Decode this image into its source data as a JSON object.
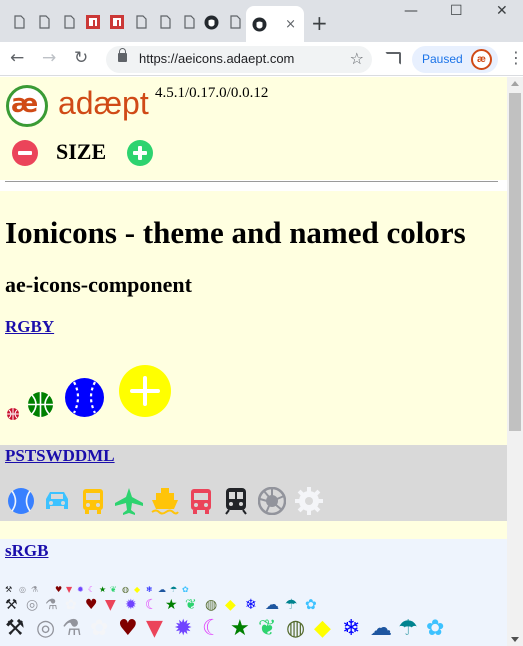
{
  "browser": {
    "tab_count_inactive": 9,
    "active_tab_close": "×",
    "new_tab": "+",
    "window_controls": {
      "minimize": "—",
      "maximize": "☐",
      "close": "✕"
    },
    "nav": {
      "back": "←",
      "forward": "→",
      "reload": "↻"
    },
    "url": "https://aeicons.adaept.com",
    "bookmark_icon": "☆",
    "profile_status": "Paused",
    "menu_icon": "⋮"
  },
  "page": {
    "logo_text": "adæpt",
    "logo_mark": "æ",
    "version": "4.5.1/0.17.0/0.0.12",
    "size_label": "SIZE",
    "title": "Ionicons - theme and named colors",
    "subtitle": "ae-icons-component",
    "sections": [
      {
        "link": "RGBY",
        "icons": [
          "basketball-icon",
          "basketball-icon",
          "baseball-icon",
          "add-circle-icon"
        ]
      },
      {
        "link": "PSTSWDDML",
        "icons": [
          "tennisball-icon",
          "car-icon",
          "bus-icon",
          "airplane-icon",
          "boat-icon",
          "bus-icon",
          "subway-icon",
          "aperture-icon",
          "cog-icon"
        ]
      },
      {
        "link": "sRGB",
        "icons": [
          "build-icon",
          "finger-print-icon",
          "flask-icon",
          "flower-icon",
          "heart-icon",
          "ice-cream-icon",
          "sunny-icon",
          "moon-icon",
          "star-icon",
          "leaf-icon",
          "globe-icon",
          "notifications-icon",
          "snow-icon",
          "rainy-icon",
          "umbrella-icon",
          "rose-icon"
        ]
      }
    ]
  },
  "colors": {
    "header_bg": "#ffffe0",
    "grey_bg": "#d9d9d9",
    "blue_bg": "#eef4fd",
    "brand_orange": "#d04a16",
    "brand_green": "#3a9b35",
    "minus_red": "#eb445a",
    "plus_green": "#2dd36f",
    "link": "#1a0dab",
    "ionic_red": "#c8102e",
    "ionic_green": "#008000",
    "ionic_blue": "#0000ff",
    "ionic_yellow": "#ffff00",
    "primary": "#3880ff",
    "secondary": "#3dc2ff",
    "tertiary": "#ffc409",
    "success": "#2dd36f",
    "warning": "#ffc409",
    "danger": "#eb445a",
    "dark": "#222428",
    "medium": "#92949c",
    "light": "#f4f5f8"
  }
}
